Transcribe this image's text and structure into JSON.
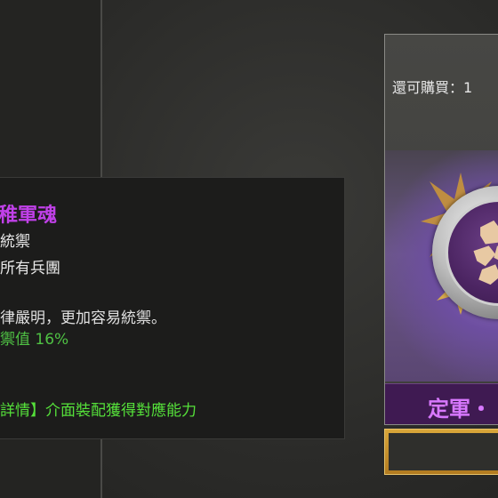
{
  "tooltip": {
    "title": "稚軍魂",
    "type": "統禦",
    "target": "所有兵團",
    "description": "律嚴明，更加容易統禦。",
    "value": "禦值 16%",
    "detail": "詳情】介面裝配獲得對應能力"
  },
  "shop": {
    "remaining": "還可購買：1",
    "item_name": "定軍・"
  },
  "colors": {
    "title": "#c040e8",
    "value": "#4fc244",
    "detail": "#55e03a",
    "name": "#d878ff",
    "buy_gold": "#d9a63a"
  },
  "icons": {
    "medal": "soldier-medal-icon",
    "sunburst": "gold-sunburst-icon"
  }
}
